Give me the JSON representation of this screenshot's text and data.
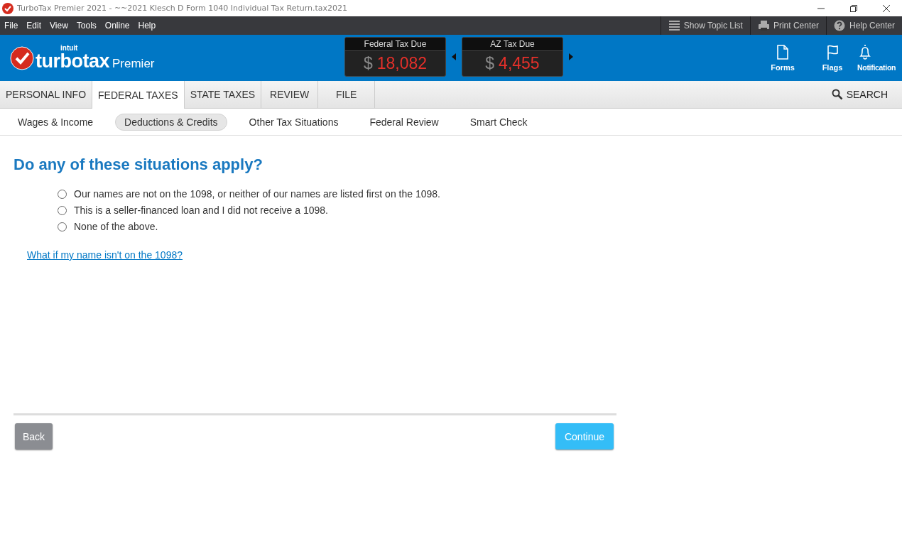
{
  "window": {
    "title": "TurboTax Premier 2021 - ~~2021 Klesch D Form 1040  Individual Tax Return.tax2021"
  },
  "menu": [
    "File",
    "Edit",
    "View",
    "Tools",
    "Online",
    "Help"
  ],
  "toolbar": [
    {
      "kind": "list",
      "label": "Show Topic List"
    },
    {
      "kind": "print",
      "label": "Print Center"
    },
    {
      "kind": "help",
      "label": "Help Center"
    }
  ],
  "brand": {
    "company": "intuit",
    "product": "turbotax",
    "edition": "Premier"
  },
  "tax_due": [
    {
      "label": "Federal Tax Due",
      "currency": "$",
      "amount": "18,082"
    },
    {
      "label": "AZ Tax Due",
      "currency": "$",
      "amount": "4,455"
    }
  ],
  "header_actions": [
    {
      "kind": "forms",
      "label": "Forms"
    },
    {
      "kind": "flags",
      "label": "Flags"
    },
    {
      "kind": "bell",
      "label": "Notification"
    }
  ],
  "tabs": [
    {
      "label": "PERSONAL INFO",
      "selected": false
    },
    {
      "label": "FEDERAL TAXES",
      "selected": true
    },
    {
      "label": "STATE TAXES",
      "selected": false
    },
    {
      "label": "REVIEW",
      "selected": false
    },
    {
      "label": "FILE",
      "selected": false
    }
  ],
  "search": {
    "label": "SEARCH"
  },
  "subtabs": [
    {
      "label": "Wages & Income",
      "selected": false
    },
    {
      "label": "Deductions & Credits",
      "selected": true
    },
    {
      "label": "Other Tax Situations",
      "selected": false
    },
    {
      "label": "Federal Review",
      "selected": false
    },
    {
      "label": "Smart Check",
      "selected": false
    }
  ],
  "question": "Do any of these situations apply?",
  "options": [
    {
      "label": "Our names are not on the 1098, or neither of our names are listed first on the 1098.",
      "selected": false
    },
    {
      "label": "This is a seller-financed loan and I did not receive a 1098.",
      "selected": false
    },
    {
      "label": "None of the above.",
      "selected": false
    }
  ],
  "help_link": "What if my name isn't on the 1098?",
  "buttons": {
    "back": "Back",
    "continue": "Continue"
  }
}
